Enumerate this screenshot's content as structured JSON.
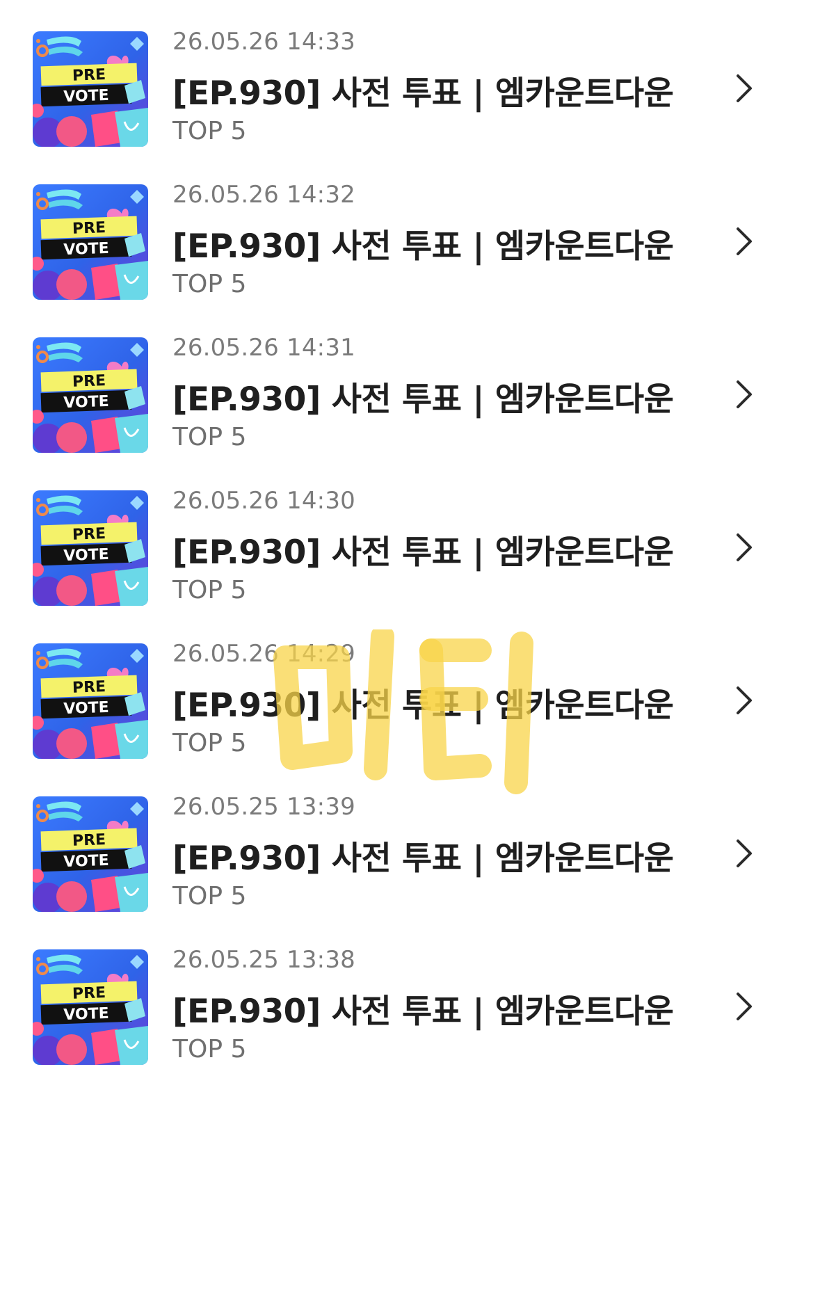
{
  "items": [
    {
      "date": "26.05.26 14:33",
      "title": "[EP.930] 사전 투표 | 엠카운트다운",
      "subtitle": "TOP 5"
    },
    {
      "date": "26.05.26 14:32",
      "title": "[EP.930] 사전 투표 | 엠카운트다운",
      "subtitle": "TOP 5"
    },
    {
      "date": "26.05.26 14:31",
      "title": "[EP.930] 사전 투표 | 엠카운트다운",
      "subtitle": "TOP 5"
    },
    {
      "date": "26.05.26 14:30",
      "title": "[EP.930] 사전 투표 | 엠카운트다운",
      "subtitle": "TOP 5"
    },
    {
      "date": "26.05.26 14:29",
      "title": "[EP.930] 사전 투표 | 엠카운트다운",
      "subtitle": "TOP 5"
    },
    {
      "date": "26.05.25 13:39",
      "title": "[EP.930] 사전 투표 | 엠카운트다운",
      "subtitle": "TOP 5"
    },
    {
      "date": "26.05.25 13:38",
      "title": "[EP.930] 사전 투표 | 엠카운트다운",
      "subtitle": "TOP 5"
    }
  ],
  "thumbnail": {
    "line1": "PRE",
    "line2": "VOTE"
  },
  "watermark": {
    "text": "미티"
  },
  "colors": {
    "date": "#7b7b7b",
    "title": "#1f1f1f",
    "subtitle": "#6f6f6f",
    "chevron": "#2b2b2b",
    "watermark": "#f8d44a"
  },
  "icons": {
    "row_arrow": "chevron-right-icon"
  }
}
